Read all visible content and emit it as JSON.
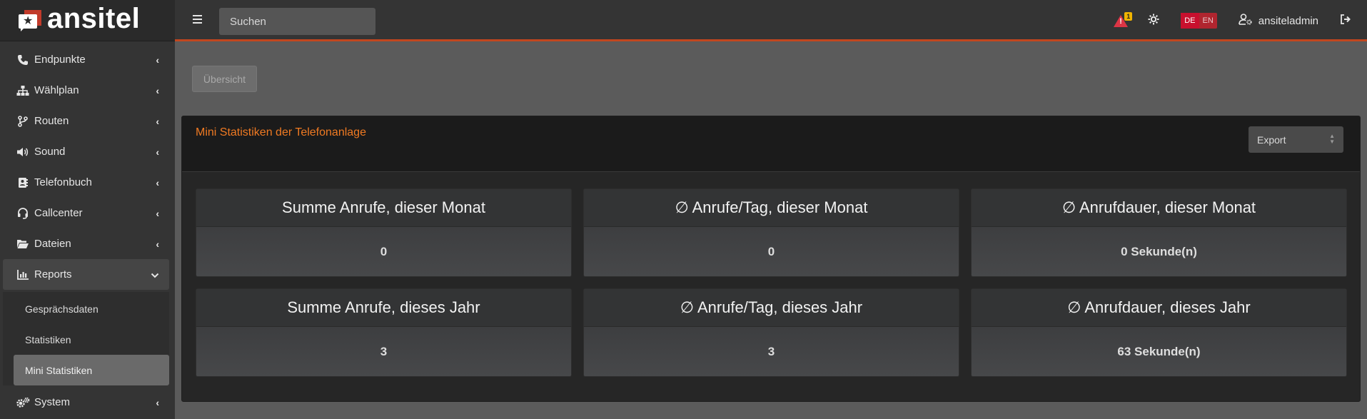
{
  "brand": {
    "name": "ansitel"
  },
  "sidebar": {
    "items": [
      {
        "label": "Endpunkte",
        "icon": "phone-icon",
        "glyph": "☎",
        "chevron": "‹"
      },
      {
        "label": "Wählplan",
        "icon": "sitemap-icon",
        "glyph": "⚘",
        "chevron": "‹"
      },
      {
        "label": "Routen",
        "icon": "code-branch-icon",
        "glyph": "⑂",
        "chevron": "‹"
      },
      {
        "label": "Sound",
        "icon": "volume-icon",
        "glyph": "🔊",
        "chevron": "‹"
      },
      {
        "label": "Telefonbuch",
        "icon": "address-book-icon",
        "glyph": "▤",
        "chevron": "‹"
      },
      {
        "label": "Callcenter",
        "icon": "headset-icon",
        "glyph": "☊",
        "chevron": "‹"
      },
      {
        "label": "Dateien",
        "icon": "folder-open-icon",
        "glyph": "▭",
        "chevron": "‹"
      },
      {
        "label": "Reports",
        "icon": "chart-bar-icon",
        "glyph": "▥",
        "chevron": "⌄"
      },
      {
        "label": "System",
        "icon": "cogs-icon",
        "glyph": "⚙",
        "chevron": "‹"
      }
    ],
    "reports_sub": [
      {
        "label": "Gesprächsdaten"
      },
      {
        "label": "Statistiken"
      },
      {
        "label": "Mini Statistiken",
        "active": true
      }
    ]
  },
  "topbar": {
    "search_placeholder": "Suchen",
    "alert_count": "1",
    "lang_de": "DE",
    "lang_en": "EN",
    "username": "ansiteladmin"
  },
  "main": {
    "tab_label": "Übersicht",
    "card_title": "Mini Statistiken der Telefonanlage",
    "export_label": "Export",
    "stats": [
      {
        "title": "Summe Anrufe, dieser Monat",
        "value": "0"
      },
      {
        "title": "∅ Anrufe/Tag, dieser Monat",
        "value": "0"
      },
      {
        "title": "∅ Anrufdauer, dieser Monat",
        "value": "0 Sekunde(n)"
      },
      {
        "title": "Summe Anrufe, dieses Jahr",
        "value": "3"
      },
      {
        "title": "∅ Anrufe/Tag, dieses Jahr",
        "value": "3"
      },
      {
        "title": "∅ Anrufdauer, dieses Jahr",
        "value": "63 Sekunde(n)"
      }
    ]
  },
  "colors": {
    "accent": "#f07a22",
    "topbar_border": "#c2461e",
    "alert": "#dc3545"
  }
}
